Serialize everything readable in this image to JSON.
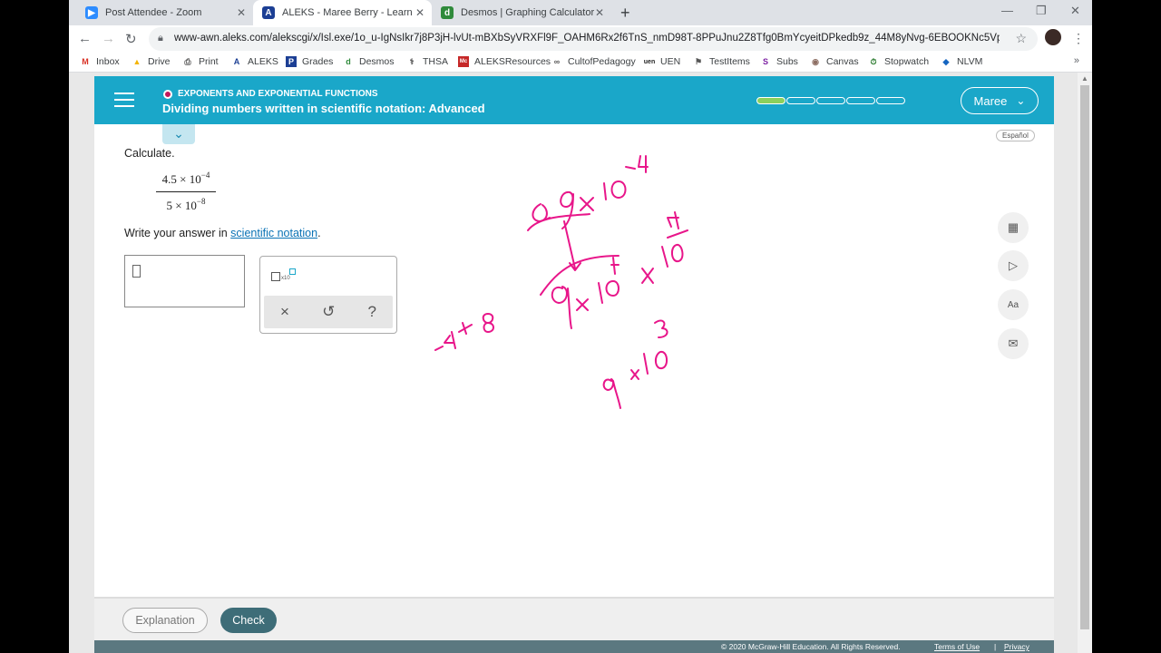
{
  "browser": {
    "tabs": [
      {
        "title": "Post Attendee - Zoom",
        "icon": "zoom-icon",
        "color": "#2d8cff"
      },
      {
        "title": "ALEKS - Maree Berry - Learn",
        "icon": "aleks-icon",
        "color": "#1c3f94"
      },
      {
        "title": "Desmos | Graphing Calculator",
        "icon": "desmos-icon",
        "color": "#2f8a3b"
      }
    ],
    "url": "www-awn.aleks.com/alekscgi/x/Isl.exe/1o_u-IgNsIkr7j8P3jH-lvUt-mBXbSyVRXFl9F_OAHM6Rx2f6TnS_nmD98T-8PPuJnu2Z8Tfg0BmYcyeitDPkedb9z_44M8yNvg-6EBOOKNc5Vpredq...",
    "bookmarks": [
      "Inbox",
      "Drive",
      "Print",
      "ALEKS",
      "Grades",
      "Desmos",
      "THSA",
      "ALEKSResources",
      "CultofPedagogy",
      "UEN",
      "TestItems",
      "Subs",
      "Canvas",
      "Stopwatch",
      "NLVM"
    ]
  },
  "aleks": {
    "topic": "EXPONENTS AND EXPONENTIAL FUNCTIONS",
    "lesson": "Dividing numbers written in scientific notation: Advanced",
    "progress_done": 1,
    "progress_total": 5,
    "user_name": "Maree",
    "espanol": "Español",
    "prompt": "Calculate.",
    "fraction": {
      "num_coef": "4.5 × 10",
      "num_exp": "−4",
      "den_coef": "5 × 10",
      "den_exp": "−8"
    },
    "instruction_pre": "Write your answer in ",
    "instruction_link": "scientific notation",
    "instruction_post": ".",
    "keypad_x10": "x10",
    "keypad_clear": "×",
    "keypad_undo": "↺",
    "keypad_help": "?",
    "explanation_button": "Explanation",
    "check_button": "Check",
    "copyright": "© 2020 McGraw-Hill Education. All Rights Reserved.",
    "terms": "Terms of Use",
    "separator": "|",
    "privacy": "Privacy"
  },
  "ink_color": "#e8168a"
}
